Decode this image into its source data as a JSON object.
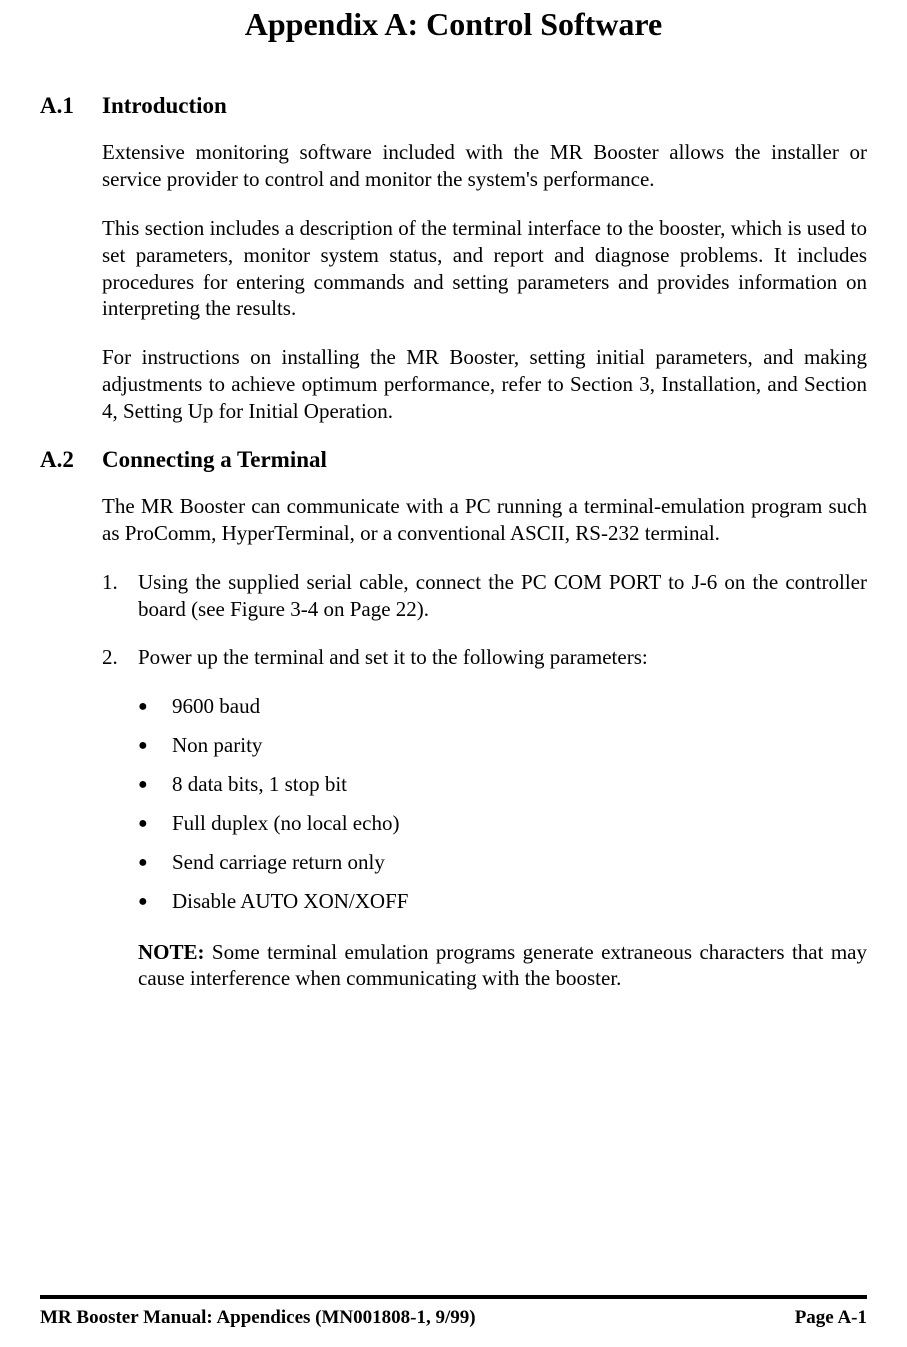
{
  "title": "Appendix A: Control Software",
  "sections": {
    "a1": {
      "num": "A.1",
      "heading": "Introduction",
      "p1": "Extensive monitoring software included with the MR Booster allows the installer or service provider to control and monitor the system's performance.",
      "p2": "This section includes a description of the terminal interface to the booster, which is used to set parameters, monitor system status, and report and diagnose problems.  It includes procedures for entering commands and setting parameters and provides information on interpreting the results.",
      "p3": "For instructions on installing the MR Booster, setting initial parameters, and making adjustments to achieve optimum performance, refer to Section 3, Installation, and Section 4, Setting Up for Initial Operation."
    },
    "a2": {
      "num": "A.2",
      "heading": "Connecting a Terminal",
      "p1": "The MR Booster can communicate with a PC running a terminal-emulation program such as ProComm, HyperTerminal, or a conventional ASCII, RS-232 terminal.",
      "ol": {
        "n1": "1.",
        "t1": "Using the supplied serial cable, connect the PC COM PORT to J-6 on the controller board (see Figure 3-4 on Page 22).",
        "n2": "2.",
        "t2": "Power up the terminal and set it to the following parameters:"
      },
      "ul": {
        "b1": "9600 baud",
        "b2": "Non parity",
        "b3": "8 data bits, 1 stop bit",
        "b4": "Full duplex (no local echo)",
        "b5": "Send carriage return only",
        "b6": "Disable AUTO XON/XOFF"
      },
      "note_label": "NOTE:",
      "note_text": " Some terminal emulation programs generate extraneous characters that may cause interference when communicating with the booster."
    }
  },
  "footer": {
    "left": "MR Booster Manual: Appendices (MN001808-1, 9/99)",
    "right": "Page A-1"
  }
}
